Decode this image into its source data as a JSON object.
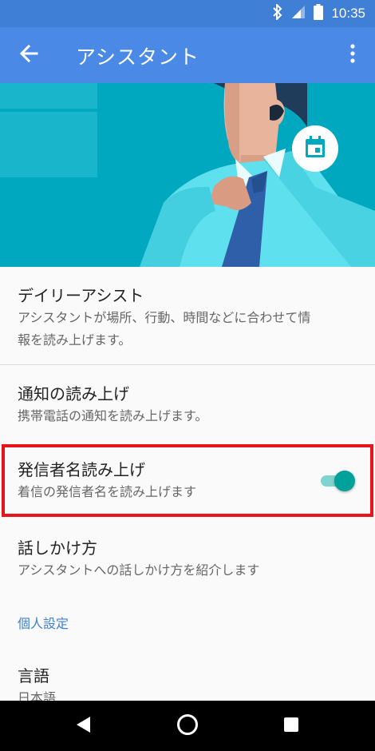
{
  "status_bar": {
    "time": "10:35",
    "icons": [
      "bluetooth-icon",
      "signal-icon",
      "battery-icon"
    ]
  },
  "app_bar": {
    "title": "アシスタント",
    "back_icon": "arrow-left-icon",
    "more_icon": "more-vertical-icon"
  },
  "hero": {
    "badge_icon": "calendar-icon"
  },
  "settings": [
    {
      "title": "デイリーアシスト",
      "subtitle_line1": "アシスタントが場所、行動、時間などに合わせて情",
      "subtitle_line2": "報を読み上げます。"
    },
    {
      "title": "通知の読み上げ",
      "subtitle": "携帯電話の通知を読み上げます。"
    },
    {
      "title": "発信者名読み上げ",
      "subtitle": "着信の発信者名を読み上げます",
      "toggle_on": true
    },
    {
      "title": "話しかけ方",
      "subtitle": "アシスタントへの話しかけ方を紹介します"
    }
  ],
  "section_header": "個人設定",
  "language": {
    "title": "言語",
    "value": "日本語"
  },
  "nav_bar": {
    "icons": [
      "back-triangle-icon",
      "home-circle-icon",
      "recents-square-icon"
    ]
  },
  "colors": {
    "app_bar": "#4a8ae6",
    "hero_bg": "#00a8bf",
    "accent_toggle": "#00a19a",
    "section_header": "#3d7fd4",
    "highlight_border": "#e8141c"
  }
}
